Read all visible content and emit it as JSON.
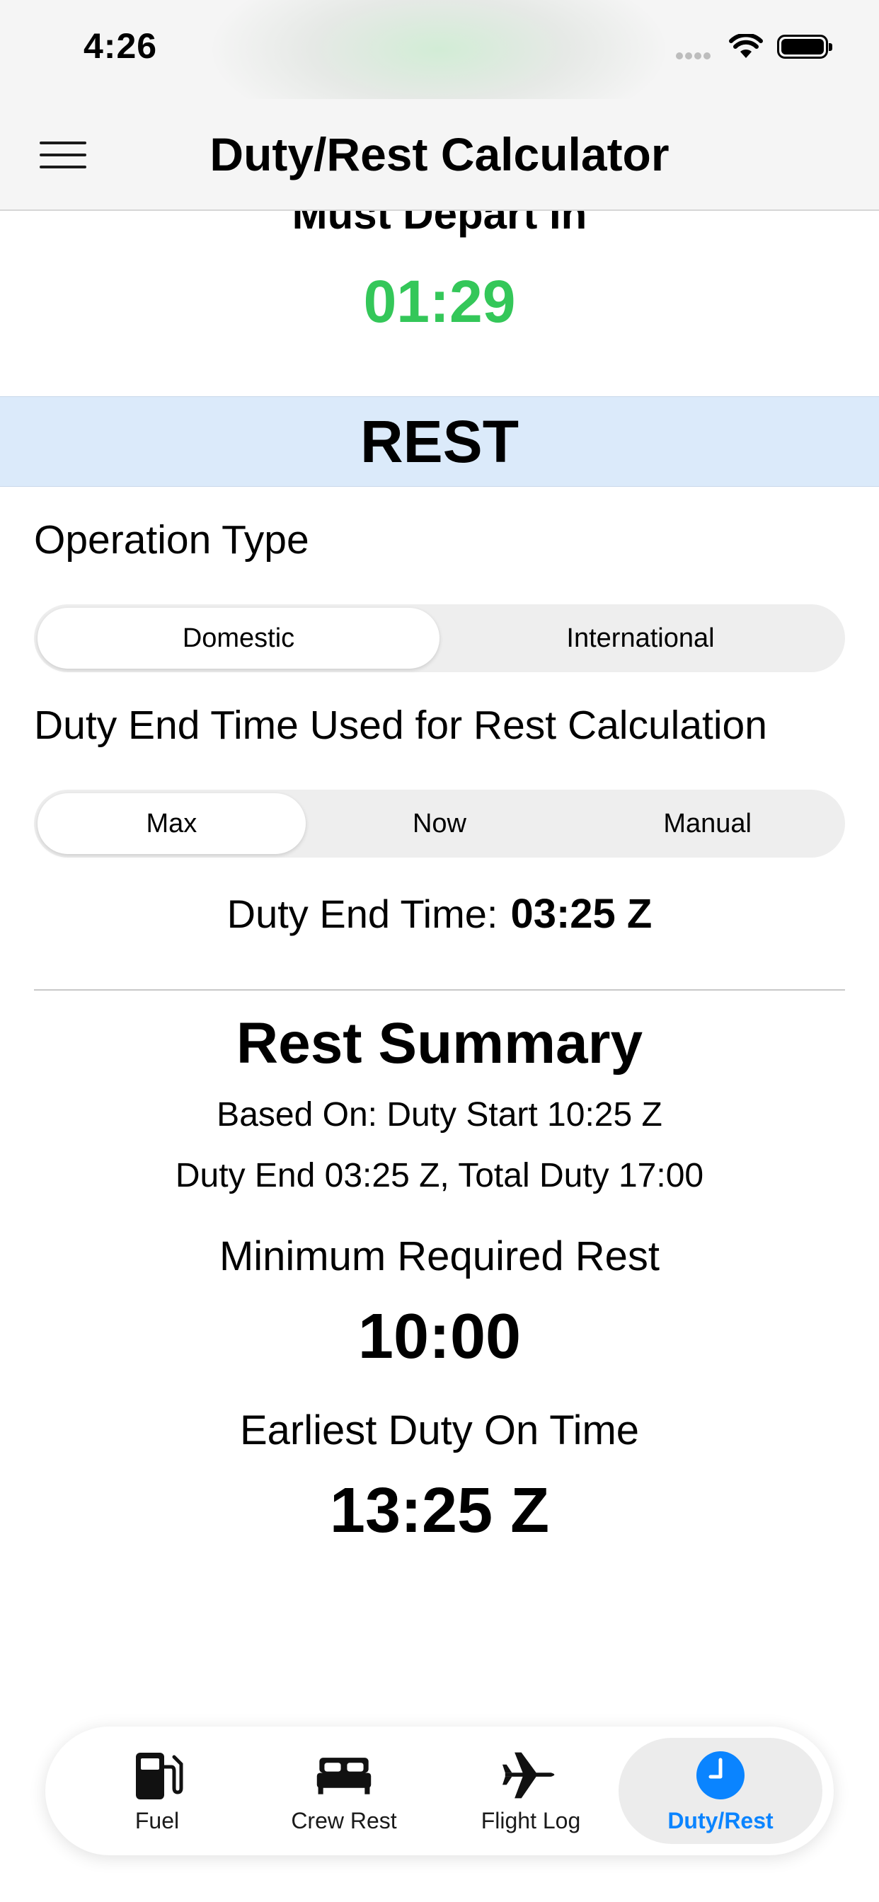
{
  "status_bar": {
    "time": "4:26"
  },
  "header": {
    "title": "Duty/Rest Calculator",
    "menu_icon": "hamburger-menu-icon"
  },
  "departure": {
    "label": "Must Depart In",
    "value": "01:29",
    "value_color": "#34c759"
  },
  "rest_section": {
    "title": "REST",
    "background": "#dbeafa"
  },
  "operation_type": {
    "label": "Operation Type",
    "options": [
      "Domestic",
      "International"
    ],
    "selected": "Domestic"
  },
  "duty_end_source": {
    "label": "Duty End Time Used for Rest Calculation",
    "options": [
      "Max",
      "Now",
      "Manual"
    ],
    "selected": "Max"
  },
  "duty_end": {
    "label": "Duty End Time:",
    "value": "03:25 Z"
  },
  "summary": {
    "title": "Rest Summary",
    "based_on": "Based On:  Duty Start 10:25 Z",
    "duty_line": "Duty End 03:25 Z, Total Duty 17:00",
    "min_rest_label": "Minimum Required Rest",
    "min_rest_value": "10:00",
    "earliest_label": "Earliest Duty On Time",
    "earliest_value": "13:25 Z"
  },
  "tab_bar": {
    "accent": "#0a84ff",
    "tabs": [
      {
        "label": "Fuel",
        "icon": "fuel-pump-icon"
      },
      {
        "label": "Crew Rest",
        "icon": "bed-icon"
      },
      {
        "label": "Flight Log",
        "icon": "airplane-icon"
      },
      {
        "label": "Duty/Rest",
        "icon": "clock-icon",
        "active": true
      }
    ]
  }
}
